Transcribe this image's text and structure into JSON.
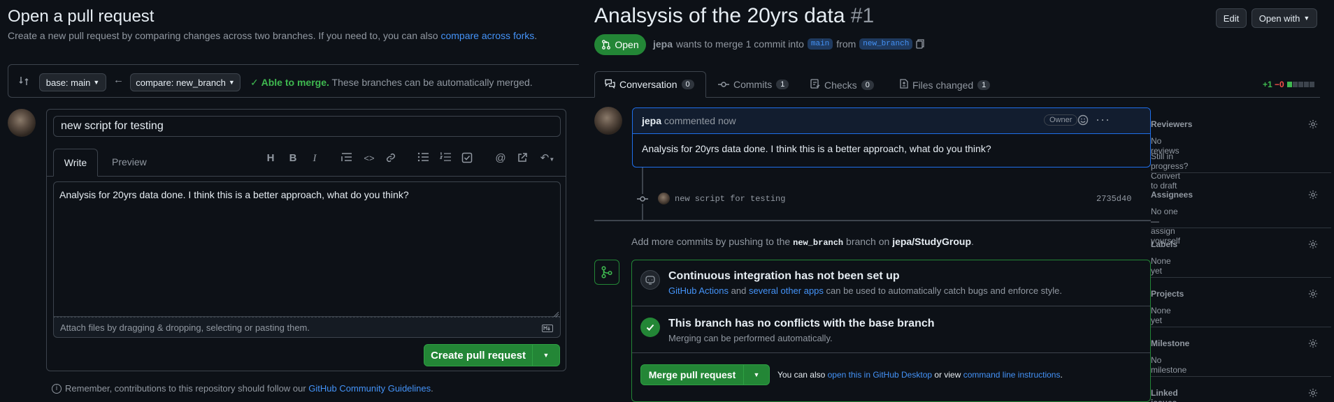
{
  "left": {
    "title": "Open a pull request",
    "subtitle": "Create a new pull request by comparing changes across two branches. If you need to, you can also",
    "subtitle_link": "compare across forks",
    "subtitle_end": ".",
    "base_label": "base: main",
    "compare_label": "compare: new_branch",
    "merge_status_strong": "Able to merge.",
    "merge_status_text": "These branches can be automatically merged.",
    "title_input_value": "new script for testing",
    "tabs": {
      "write": "Write",
      "preview": "Preview"
    },
    "body_text": "Analysis for 20yrs data done. I think this is a better approach, what do you think?",
    "attach_hint": "Attach files by dragging & dropping, selecting or pasting them.",
    "create_button": "Create pull request",
    "footer_text": "Remember, contributions to this repository should follow our",
    "footer_link": "GitHub Community Guidelines",
    "footer_end": "."
  },
  "right": {
    "title": "Analsysis of the 20yrs data",
    "number": "#1",
    "edit_button": "Edit",
    "open_with_button": "Open with",
    "state_badge": "Open",
    "meta_user": "jepa",
    "meta_text1": "wants to merge 1 commit into",
    "base_branch": "main",
    "meta_text2": "from",
    "head_branch": "new_branch",
    "tabs": [
      {
        "label": "Conversation",
        "count": "0"
      },
      {
        "label": "Commits",
        "count": "1"
      },
      {
        "label": "Checks",
        "count": "0"
      },
      {
        "label": "Files changed",
        "count": "1"
      }
    ],
    "diffstat_add": "+1",
    "diffstat_del": "−0",
    "comment": {
      "author": "jepa",
      "action": "commented now",
      "role": "Owner",
      "body": "Analysis for 20yrs data done. I think this is a better approach, what do you think?"
    },
    "commit": {
      "message": "new script for testing",
      "sha": "2735d40"
    },
    "push_hint_1": "Add more commits by pushing to the",
    "push_hint_branch": "new_branch",
    "push_hint_2": "branch on",
    "push_hint_repo": "jepa/StudyGroup",
    "push_hint_end": ".",
    "ci": {
      "title": "Continuous integration has not been set up",
      "link1": "GitHub Actions",
      "and": "and",
      "link2": "several other apps",
      "text": "can be used to automatically catch bugs and enforce style."
    },
    "conflicts": {
      "title": "This branch has no conflicts with the base branch",
      "text": "Merging can be performed automatically."
    },
    "merge_button": "Merge pull request",
    "merge_hint_1": "You can also",
    "merge_hint_link1": "open this in GitHub Desktop",
    "merge_hint_2": "or view",
    "merge_hint_link2": "command line instructions",
    "merge_hint_end": ".",
    "sidebar": {
      "reviewers": {
        "label": "Reviewers",
        "value": "No reviews",
        "extra": "Still in progress? Convert to draft"
      },
      "assignees": {
        "label": "Assignees",
        "value": "No one—assign yourself"
      },
      "labels": {
        "label": "Labels",
        "value": "None yet"
      },
      "projects": {
        "label": "Projects",
        "value": "None yet"
      },
      "milestone": {
        "label": "Milestone",
        "value": "No milestone"
      },
      "linked": {
        "label": "Linked issues"
      }
    }
  }
}
